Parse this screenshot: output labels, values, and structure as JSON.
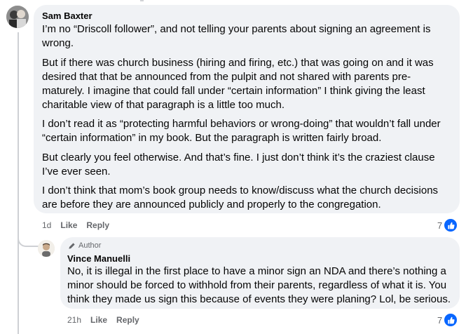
{
  "comment": {
    "author": "Sam Baxter",
    "paragraphs": [
      "I’m no “Driscoll follower”, and not telling your parents about signing an agreement is wrong.",
      "But if there was church business (hiring and firing, etc.) that was going on and it was desired that that be announced from the pulpit and not shared with parents pre-maturely. I imagine that could fall under “certain information” I think giving the least charitable view of that paragraph is a little too much.",
      "I don’t read it as “protecting harmful behaviors or wrong-doing” that wouldn’t fall under “certain information” in my book. But the paragraph is written fairly broad.",
      "But clearly you feel otherwise. And that’s fine. I just don’t think it’s the craziest clause I’ve ever seen.",
      "I don’t think that mom’s book group needs to know/discuss what the church decisions are before they are announced publicly and properly to the congregation."
    ],
    "lines": [
      "I’m no “Driscoll follower”, and not telling your parents about signing an agreement is",
      "wrong.",
      "But if there was church business (hiring and firing, etc.) that was going on and it was",
      "desired that that be announced from the pulpit and not shared with parents pre-",
      "maturely. I imagine that could fall under “certain information” I think giving the least",
      "charitable view of that paragraph is a little too much.",
      "I don’t read it as “protecting harmful behaviors or wrong-doing” that wouldn’t fall under",
      "“certain information” in my book. But the paragraph is written fairly broad.",
      "But clearly you feel otherwise. And that’s fine. I just don’t think it’s the craziest clause",
      "I’ve ever seen.",
      "I don’t think that mom’s book group needs to know/discuss what the church decisions",
      "are before they are announced publicly and properly to the congregation."
    ],
    "timestamp": "1d",
    "like_label": "Like",
    "reply_label": "Reply",
    "reaction_count": "7",
    "reaction_icon": "thumbs-up-icon",
    "accent_color": "#0866ff"
  },
  "reply": {
    "badge_label": "Author",
    "badge_icon": "pen-icon",
    "author": "Vince Manuelli",
    "lines": [
      "No, it is illegal in the first place to have a minor sign an NDA and there’s nothing a",
      "minor should be forced to withhold from their parents, regardless of what it is. You",
      "think they made us sign this because of events they were planing? Lol, be serious."
    ],
    "timestamp": "21h",
    "like_label": "Like",
    "reply_label": "Reply",
    "reaction_count": "7",
    "reaction_icon": "thumbs-up-icon"
  }
}
